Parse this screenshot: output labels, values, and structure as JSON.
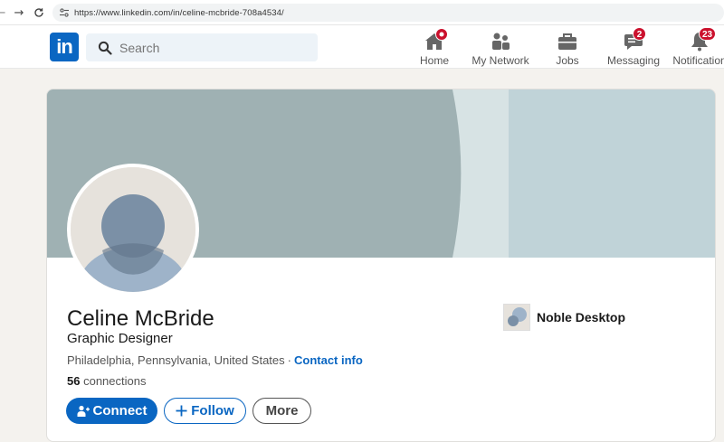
{
  "browser": {
    "url": "https://www.linkedin.com/in/celine-mcbride-708a4534/"
  },
  "header": {
    "logo_text": "in",
    "search_placeholder": "Search",
    "nav": [
      {
        "label": "Home",
        "icon": "home-icon",
        "badge": ""
      },
      {
        "label": "My Network",
        "icon": "network-icon",
        "badge": ""
      },
      {
        "label": "Jobs",
        "icon": "briefcase-icon",
        "badge": ""
      },
      {
        "label": "Messaging",
        "icon": "messaging-icon",
        "badge": "2"
      },
      {
        "label": "Notification",
        "icon": "bell-icon",
        "badge": "23"
      }
    ]
  },
  "profile": {
    "name": "Celine McBride",
    "headline": "Graphic Designer",
    "location": "Philadelphia, Pennsylvania, United States",
    "separator": "·",
    "contact_info_label": "Contact info",
    "connections_count": "56",
    "connections_label": "connections",
    "company": "Noble Desktop",
    "buttons": {
      "connect": "Connect",
      "follow": "Follow",
      "more": "More"
    }
  },
  "colors": {
    "brand": "#0a66c2",
    "badge": "#cb112d",
    "banner_light": "#c0d3d8",
    "banner_dark": "#9fb1b3"
  }
}
